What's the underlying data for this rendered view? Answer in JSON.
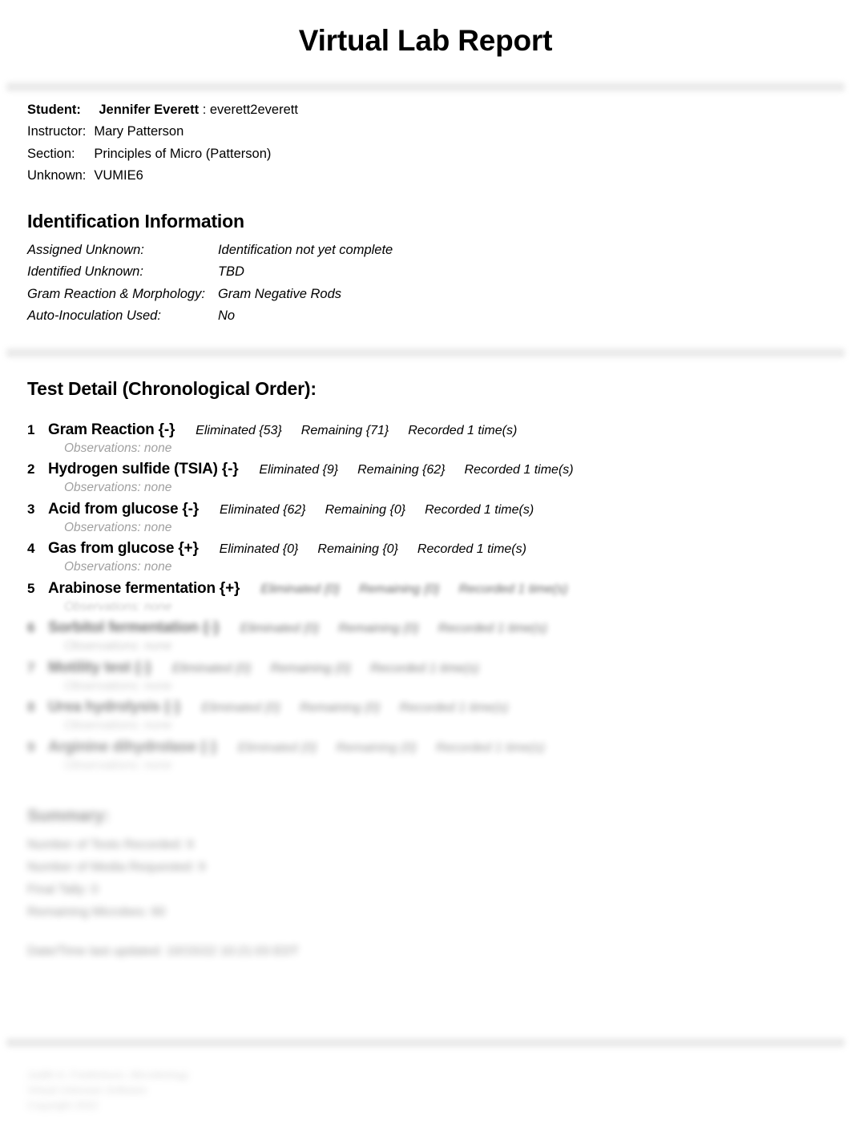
{
  "title": "Virtual Lab Report",
  "student_info": {
    "rows": [
      {
        "label": "Student:",
        "value": "Jennifer Everett",
        "suffix": ": everett2everett",
        "bold": true
      },
      {
        "label": "Instructor:",
        "value": "Mary Patterson",
        "suffix": "",
        "bold": false
      },
      {
        "label": "Section:",
        "value": "Principles of Micro (Patterson)",
        "suffix": "",
        "bold": false
      },
      {
        "label": "Unknown:",
        "value": "VUMIE6",
        "suffix": "",
        "bold": false
      }
    ]
  },
  "identification": {
    "heading": "Identification Information",
    "rows": [
      {
        "label": "Assigned Unknown:",
        "value": "Identification not yet complete"
      },
      {
        "label": "Identified Unknown:",
        "value": "TBD"
      },
      {
        "label": "Gram Reaction & Morphology:",
        "value": "Gram Negative Rods"
      },
      {
        "label": "Auto-Inoculation Used:",
        "value": "No"
      }
    ]
  },
  "test_detail": {
    "heading": "Test Detail (Chronological Order):",
    "observations_prefix": "Observations: none",
    "tests": [
      {
        "num": "1",
        "name": "Gram Reaction {-}",
        "eliminated": "Eliminated {53}",
        "remaining": "Remaining {71}",
        "recorded": "Recorded 1 time(s)",
        "observations": "Observations: none"
      },
      {
        "num": "2",
        "name": "Hydrogen sulfide (TSIA) {-}",
        "eliminated": "Eliminated {9}",
        "remaining": "Remaining {62}",
        "recorded": "Recorded 1 time(s)",
        "observations": "Observations: none"
      },
      {
        "num": "3",
        "name": "Acid from glucose {-}",
        "eliminated": "Eliminated {62}",
        "remaining": "Remaining {0}",
        "recorded": "Recorded 1 time(s)",
        "observations": "Observations: none"
      },
      {
        "num": "4",
        "name": "Gas from glucose {+}",
        "eliminated": "Eliminated {0}",
        "remaining": "Remaining {0}",
        "recorded": "Recorded 1 time(s)",
        "observations": "Observations: none"
      },
      {
        "num": "5",
        "name": "Arabinose fermentation {+}",
        "eliminated": "Eliminated {0}",
        "remaining": "Remaining {0}",
        "recorded": "Recorded 1 time(s)",
        "observations": "Observations: none"
      },
      {
        "num": "6",
        "name": "Sorbitol fermentation {-}",
        "eliminated": "Eliminated {0}",
        "remaining": "Remaining {0}",
        "recorded": "Recorded 1 time(s)",
        "observations": "Observations: none"
      },
      {
        "num": "7",
        "name": "Motility test {-}",
        "eliminated": "Eliminated {0}",
        "remaining": "Remaining {0}",
        "recorded": "Recorded 1 time(s)",
        "observations": "Observations: none"
      },
      {
        "num": "8",
        "name": "Urea hydrolysis {-}",
        "eliminated": "Eliminated {0}",
        "remaining": "Remaining {0}",
        "recorded": "Recorded 1 time(s)",
        "observations": "Observations: none"
      },
      {
        "num": "9",
        "name": "Arginine dihydrolase {-}",
        "eliminated": "Eliminated {0}",
        "remaining": "Remaining {0}",
        "recorded": "Recorded 1 time(s)",
        "observations": "Observations: none"
      }
    ]
  },
  "summary": {
    "heading": "Summary:",
    "lines": [
      "Number of Tests Recorded: 9",
      "Number of Media Requested: 9",
      "Final Tally: 0",
      "Remaining Microbes: 60"
    ],
    "updated": "Date/Time last updated: 10/15/22 10:21:03 EDT"
  },
  "footer": {
    "lines": [
      "Judith A. Fredrickson, Microbiology",
      "Virtual Unknown Software",
      "Copyright 2022"
    ]
  }
}
